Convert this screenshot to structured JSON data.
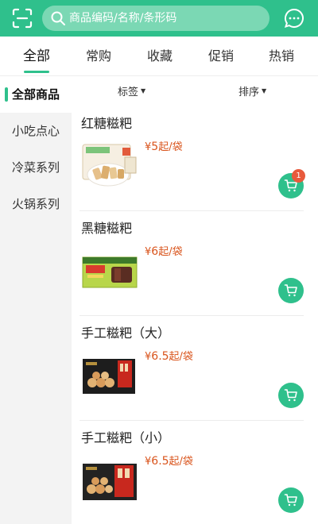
{
  "header": {
    "search_placeholder": "商品编码/名称/条形码",
    "accent_color": "#2fc08c"
  },
  "tabs": [
    {
      "label": "全部",
      "active": true
    },
    {
      "label": "常购"
    },
    {
      "label": "收藏"
    },
    {
      "label": "促销"
    },
    {
      "label": "热销"
    }
  ],
  "sidebar": {
    "items": [
      {
        "label": "全部商品",
        "active": true
      },
      {
        "label": "小吃点心"
      },
      {
        "label": "冷菜系列"
      },
      {
        "label": "火锅系列"
      }
    ]
  },
  "filters": {
    "tag_label": "标签",
    "sort_label": "排序"
  },
  "products": [
    {
      "name": "红糖糍粑",
      "currency": "¥",
      "price": "5",
      "unit": "起/袋",
      "cart_count": "1",
      "image_icon": "brown-sugar-ciba-package"
    },
    {
      "name": "黑糖糍粑",
      "currency": "¥",
      "price": "6",
      "unit": "起/袋",
      "image_icon": "black-sugar-ciba-package"
    },
    {
      "name": "手工糍粑（大）",
      "currency": "¥",
      "price": "6.5",
      "unit": "起/袋",
      "image_icon": "handmade-ciba-large-package"
    },
    {
      "name": "手工糍粑（小）",
      "currency": "¥",
      "price": "6.5",
      "unit": "起/袋",
      "image_icon": "handmade-ciba-small-package"
    }
  ],
  "colors": {
    "price": "#d9541c",
    "badge": "#e85a3c"
  }
}
